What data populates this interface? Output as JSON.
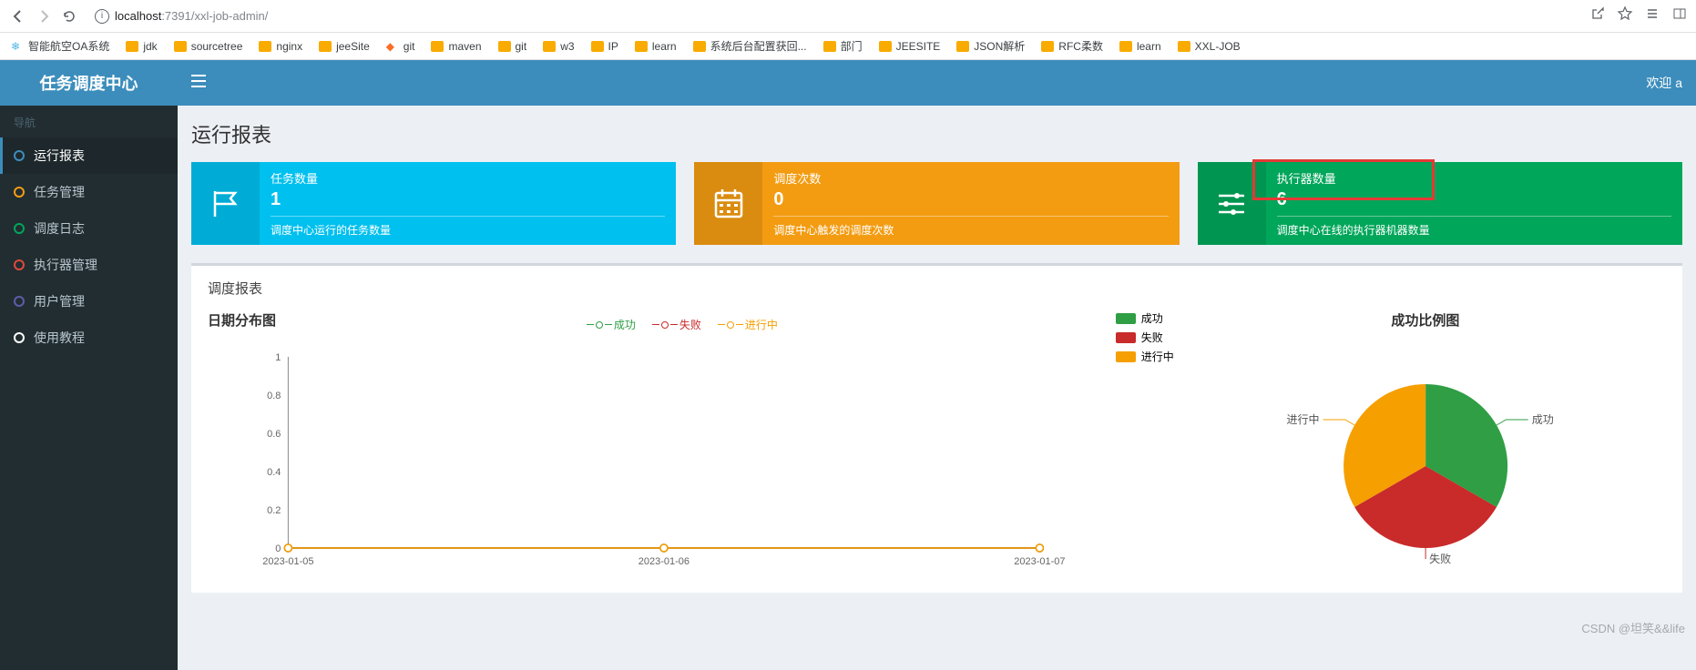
{
  "browser": {
    "url_host": "localhost",
    "url_port": ":7391",
    "url_path": "/xxl-job-admin/"
  },
  "bookmarks": [
    {
      "label": "智能航空OA系统",
      "type": "app-blue"
    },
    {
      "label": "jdk",
      "type": "folder"
    },
    {
      "label": "sourcetree",
      "type": "folder"
    },
    {
      "label": "nginx",
      "type": "folder"
    },
    {
      "label": "jeeSite",
      "type": "folder"
    },
    {
      "label": "git",
      "type": "app-orange"
    },
    {
      "label": "maven",
      "type": "folder"
    },
    {
      "label": "git",
      "type": "folder"
    },
    {
      "label": "w3",
      "type": "folder"
    },
    {
      "label": "IP",
      "type": "folder"
    },
    {
      "label": "learn",
      "type": "folder"
    },
    {
      "label": "系统后台配置获回...",
      "type": "folder"
    },
    {
      "label": "部门",
      "type": "folder"
    },
    {
      "label": "JEESITE",
      "type": "folder"
    },
    {
      "label": "JSON解析",
      "type": "folder"
    },
    {
      "label": "RFC柔数",
      "type": "folder"
    },
    {
      "label": "learn",
      "type": "folder"
    },
    {
      "label": "XXL-JOB",
      "type": "folder"
    }
  ],
  "header": {
    "logo": "任务调度中心",
    "welcome": "欢迎 a"
  },
  "sidebar": {
    "section": "导航",
    "items": [
      {
        "label": "运行报表",
        "color": "blue",
        "active": true
      },
      {
        "label": "任务管理",
        "color": "orange"
      },
      {
        "label": "调度日志",
        "color": "green"
      },
      {
        "label": "执行器管理",
        "color": "red"
      },
      {
        "label": "用户管理",
        "color": "purple"
      },
      {
        "label": "使用教程",
        "color": "white"
      }
    ]
  },
  "page": {
    "title": "运行报表"
  },
  "stats": [
    {
      "label": "任务数量",
      "value": "1",
      "desc": "调度中心运行的任务数量",
      "color": "teal",
      "icon": "flag"
    },
    {
      "label": "调度次数",
      "value": "0",
      "desc": "调度中心触发的调度次数",
      "color": "orange",
      "icon": "calendar"
    },
    {
      "label": "执行器数量",
      "value": "6",
      "desc": "调度中心在线的执行器机器数量",
      "color": "green",
      "icon": "sliders",
      "highlight": true
    }
  ],
  "panel": {
    "title": "调度报表",
    "line_title": "日期分布图",
    "pie_title": "成功比例图"
  },
  "legend": {
    "success": "成功",
    "fail": "失败",
    "running": "进行中"
  },
  "colors": {
    "success": "#2f9e44",
    "fail": "#c92a2a",
    "running": "#f59f00"
  },
  "chart_data": [
    {
      "type": "line",
      "title": "日期分布图",
      "categories": [
        "2023-01-05",
        "2023-01-06",
        "2023-01-07"
      ],
      "series": [
        {
          "name": "成功",
          "values": [
            0,
            0,
            0
          ]
        },
        {
          "name": "失败",
          "values": [
            0,
            0,
            0
          ]
        },
        {
          "name": "进行中",
          "values": [
            0,
            0,
            0
          ]
        }
      ],
      "ylim": [
        0,
        1
      ],
      "yticks": [
        0,
        0.2,
        0.4,
        0.6,
        0.8,
        1
      ]
    },
    {
      "type": "pie",
      "title": "成功比例图",
      "series": [
        {
          "name": "成功",
          "value": 33.3
        },
        {
          "name": "失败",
          "value": 33.3
        },
        {
          "name": "进行中",
          "value": 33.3
        }
      ]
    }
  ],
  "watermark": "CSDN @坦笑&&life"
}
